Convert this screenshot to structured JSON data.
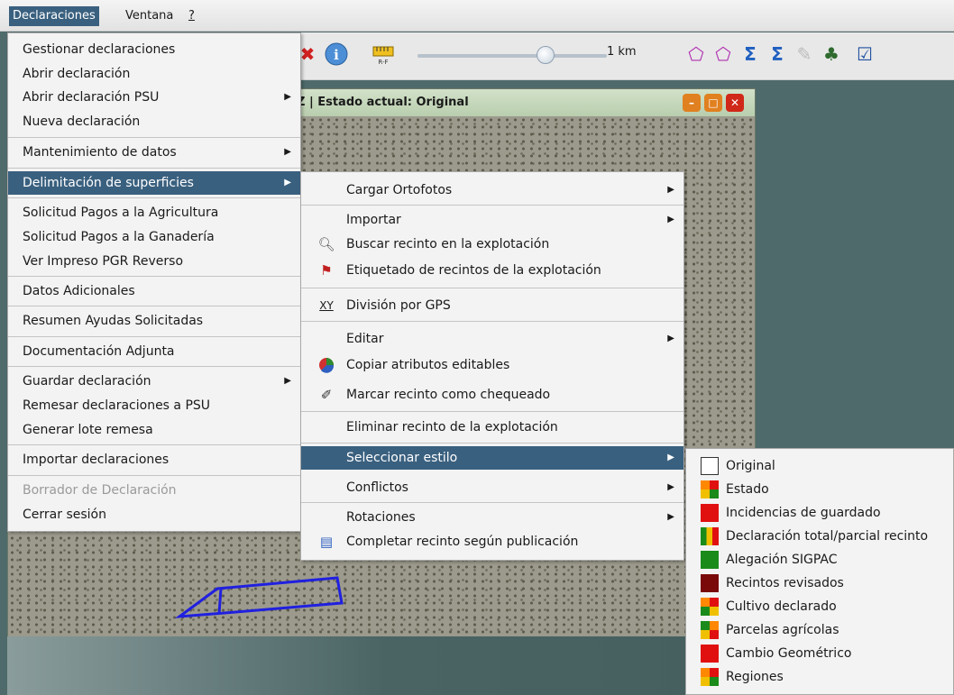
{
  "menubar": {
    "items": [
      {
        "label": "Declaraciones"
      },
      {
        "label": "Ventana"
      },
      {
        "label": "?"
      }
    ]
  },
  "toolbar": {
    "scale_label": "1 km",
    "icons": [
      "close-icon",
      "info-icon",
      "ruler-icon",
      "select-add-icon",
      "select-remove-icon",
      "sum-icon",
      "sum-filter-icon",
      "edit-icon",
      "tree-icon",
      "edit-box-icon"
    ],
    "ruler_caption": "R-F"
  },
  "map_window": {
    "title": "Z | Estado actual: Original",
    "buttons": [
      "minimize",
      "maximize",
      "close"
    ]
  },
  "main_menu": {
    "items": [
      {
        "label": "Gestionar declaraciones"
      },
      {
        "label": "Abrir declaración"
      },
      {
        "label": "Abrir declaración PSU"
      },
      {
        "label": "Nueva declaración"
      },
      {
        "label": "Mantenimiento de datos"
      },
      {
        "label": "Delimitación de superficies"
      },
      {
        "label": "Solicitud Pagos a la Agricultura"
      },
      {
        "label": "Solicitud Pagos a la Ganadería"
      },
      {
        "label": "Ver Impreso PGR Reverso"
      },
      {
        "label": "Datos Adicionales"
      },
      {
        "label": "Resumen Ayudas Solicitadas"
      },
      {
        "label": "Documentación Adjunta"
      },
      {
        "label": "Guardar declaración"
      },
      {
        "label": "Remesar declaraciones a PSU"
      },
      {
        "label": "Generar lote remesa"
      },
      {
        "label": "Importar declaraciones"
      },
      {
        "label": "Borrador de Declaración"
      },
      {
        "label": "Cerrar sesión"
      }
    ]
  },
  "sub_menu": {
    "items": [
      {
        "label": "Cargar Ortofotos"
      },
      {
        "label": "Importar"
      },
      {
        "label": "Buscar recinto en la explotación"
      },
      {
        "label": "Etiquetado de recintos de la explotación"
      },
      {
        "label": "División por GPS",
        "icon_text": "XY"
      },
      {
        "label": "Editar"
      },
      {
        "label": "Copiar atributos editables"
      },
      {
        "label": "Marcar recinto como chequeado"
      },
      {
        "label": "Eliminar recinto de la explotación"
      },
      {
        "label": "Seleccionar estilo"
      },
      {
        "label": "Conflictos"
      },
      {
        "label": "Rotaciones"
      },
      {
        "label": "Completar recinto según publicación"
      }
    ]
  },
  "style_menu": {
    "items": [
      {
        "label": "Original"
      },
      {
        "label": "Estado"
      },
      {
        "label": "Incidencias de guardado"
      },
      {
        "label": "Declaración total/parcial recinto"
      },
      {
        "label": "Alegación SIGPAC"
      },
      {
        "label": "Recintos revisados"
      },
      {
        "label": "Cultivo declarado"
      },
      {
        "label": "Parcelas agrícolas"
      },
      {
        "label": "Cambio Geométrico"
      },
      {
        "label": "Regiones"
      }
    ]
  },
  "colors": {
    "highlight": "#3a607f",
    "red": "#e01010",
    "green": "#1a8a1a",
    "yellow": "#f0c000",
    "darkred": "#7a0a0a",
    "orange": "#ff8800"
  }
}
